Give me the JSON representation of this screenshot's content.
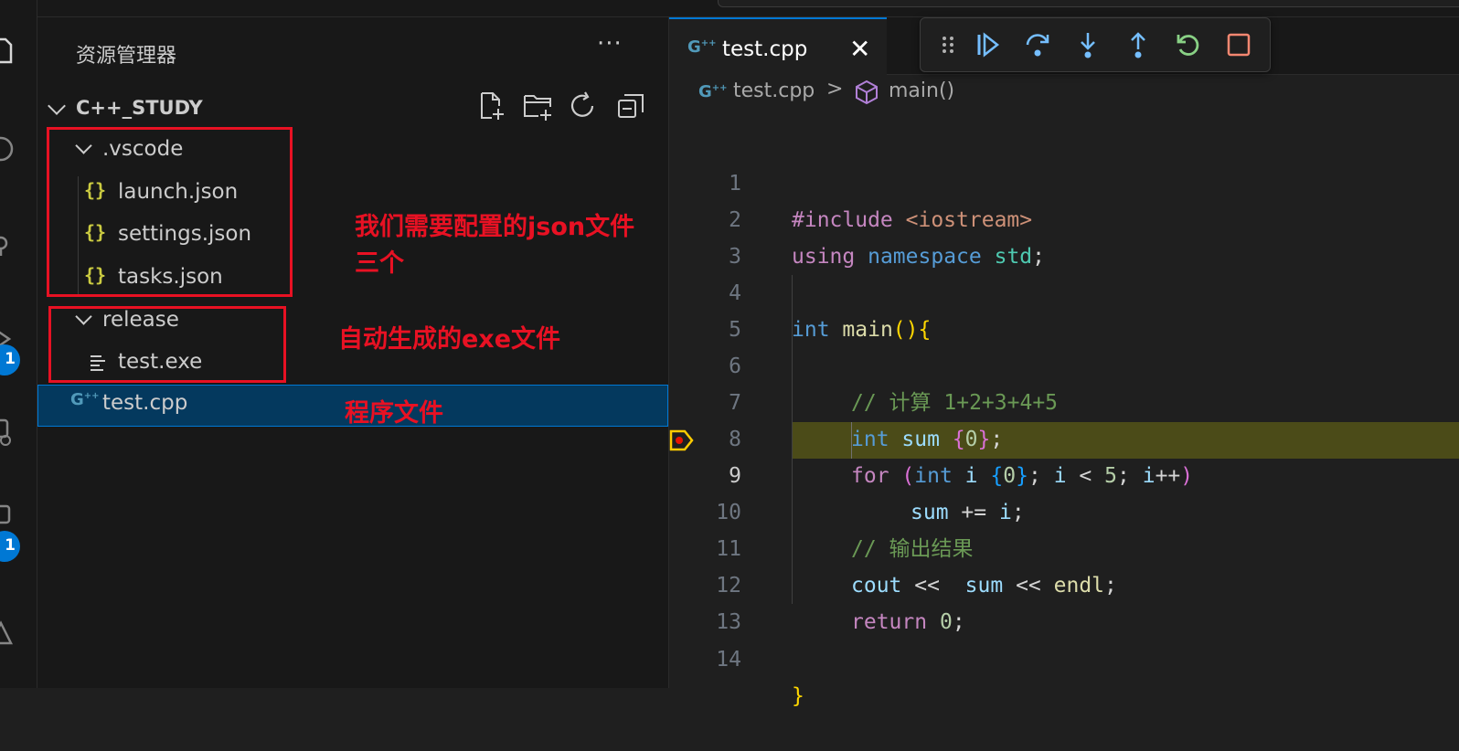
{
  "explorer": {
    "title": "资源管理器",
    "more_icon": "ellipsis-icon",
    "folder_name": "C++_STUDY",
    "toolbar_icons": [
      "new-file-icon",
      "new-folder-icon",
      "refresh-icon",
      "collapse-all-icon"
    ],
    "tree": {
      "vscode_folder": ".vscode",
      "launch": "launch.json",
      "settings": "settings.json",
      "tasks": "tasks.json",
      "release_folder": "release",
      "exe": "test.exe",
      "cpp": "test.cpp"
    }
  },
  "activity_bar": {
    "badges": [
      "1",
      "1"
    ]
  },
  "annotations": {
    "json": "我们需要配置的json文件",
    "json_line2": "三个",
    "exe": "自动生成的exe文件",
    "program": "程序文件"
  },
  "editor": {
    "tab": {
      "label": "test.cpp",
      "close": "✕"
    },
    "breadcrumb": {
      "file": "test.cpp",
      "separator": ">",
      "symbol": "main()"
    },
    "debug_toolbar": [
      "drag-handle-icon",
      "continue-icon",
      "step-over-icon",
      "step-into-icon",
      "step-out-icon",
      "restart-icon",
      "stop-icon"
    ],
    "line_numbers": [
      "1",
      "2",
      "3",
      "4",
      "5",
      "6",
      "7",
      "8",
      "9",
      "10",
      "11",
      "12",
      "13",
      "14"
    ],
    "current_line": "9",
    "code": {
      "l1": {
        "directive": "#include",
        "header": "<iostream>"
      },
      "l2": {
        "using": "using",
        "namespace": "namespace",
        "std": "std",
        "semi": ";"
      },
      "l4": {
        "int": "int",
        "main": "main",
        "paren": "()",
        "brace": "{"
      },
      "l6": {
        "comment": "// 计算 1+2+3+4+5"
      },
      "l7": {
        "int": "int",
        "sum": "sum",
        "open": "{",
        "zero": "0",
        "close": "}",
        "semi": ";"
      },
      "l8": {
        "for": "for",
        "p_open": "(",
        "int": "int",
        "i": "i",
        "b_open": "{",
        "zero": "0",
        "b_close": "}",
        "semi1": ";",
        "i2": "i",
        "lt": "<",
        "five": "5",
        "semi2": ";",
        "i3": "i",
        "pp": "++",
        "p_close": ")"
      },
      "l9": {
        "sum": "sum",
        "op": "+=",
        "i": "i",
        "semi": ";"
      },
      "l10": {
        "comment": "// 输出结果"
      },
      "l11": {
        "cout": "cout",
        "op1": "<<",
        "sum": "sum",
        "op2": "<<",
        "endl": "endl",
        "semi": ";"
      },
      "l12": {
        "return": "return",
        "zero": "0",
        "semi": ";"
      },
      "l14": {
        "brace": "}"
      }
    }
  }
}
